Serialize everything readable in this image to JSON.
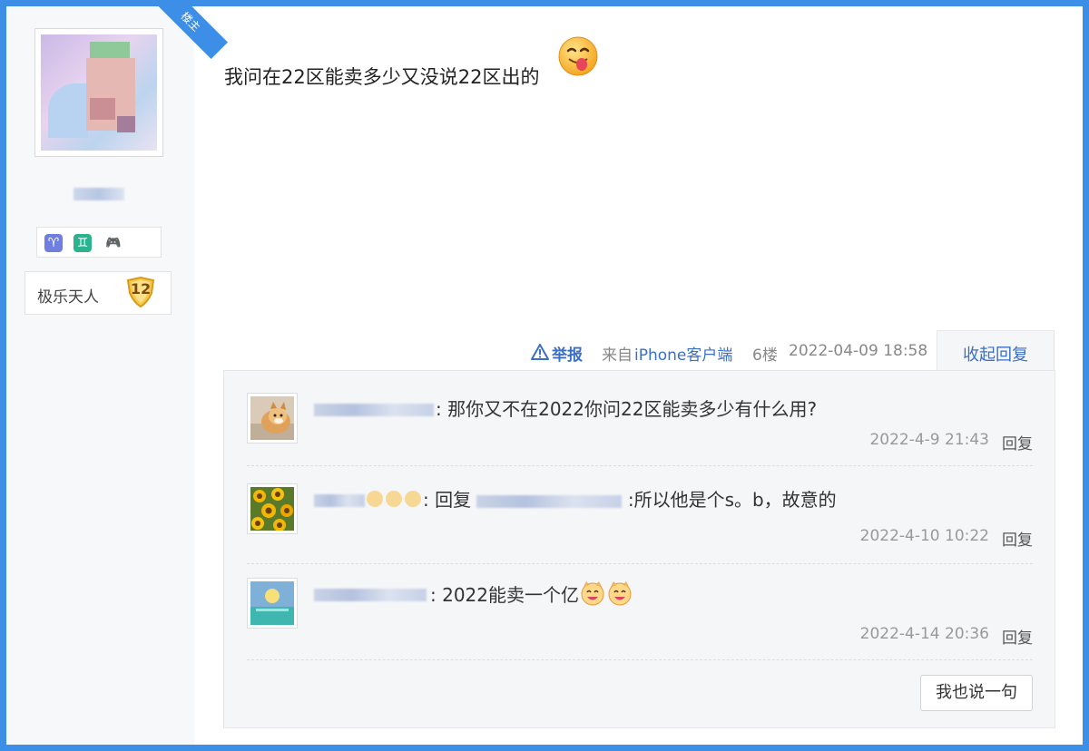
{
  "author": {
    "ribbon_label": "楼主",
    "level_title": "极乐天人",
    "level_number": "12",
    "badges": [
      "aries-icon",
      "gemini-icon",
      "game-controller-icon"
    ]
  },
  "post": {
    "content": "我问在22区能卖多少又没说22区出的",
    "emoji": "drooling-face-emoji"
  },
  "meta": {
    "report_label": "举报",
    "from_label": "来自",
    "client_label": "iPhone客户端",
    "floor": "6楼",
    "time": "2022-04-09 18:58",
    "collapse_label": "收起回复"
  },
  "replies": [
    {
      "text": ": 那你又不在2022你问22区能卖多少有什么用?",
      "time": "2022-4-9 21:43",
      "reply_label": "回复",
      "avatar": "shiba-dog-avatar"
    },
    {
      "text_prefix": ": 回复",
      "text_suffix": " :所以他是个s。b，故意的",
      "time": "2022-4-10 10:22",
      "reply_label": "回复",
      "avatar": "sunflower-avatar"
    },
    {
      "text": ": 2022能卖一个亿",
      "time": "2022-4-14 20:36",
      "reply_label": "回复",
      "avatar": "sunset-sea-avatar"
    }
  ],
  "say_button_label": "我也说一句",
  "colors": {
    "frame_blue": "#3d8ee6",
    "link_blue": "#3a6fc4",
    "panel_bg": "#f5f6f8"
  }
}
